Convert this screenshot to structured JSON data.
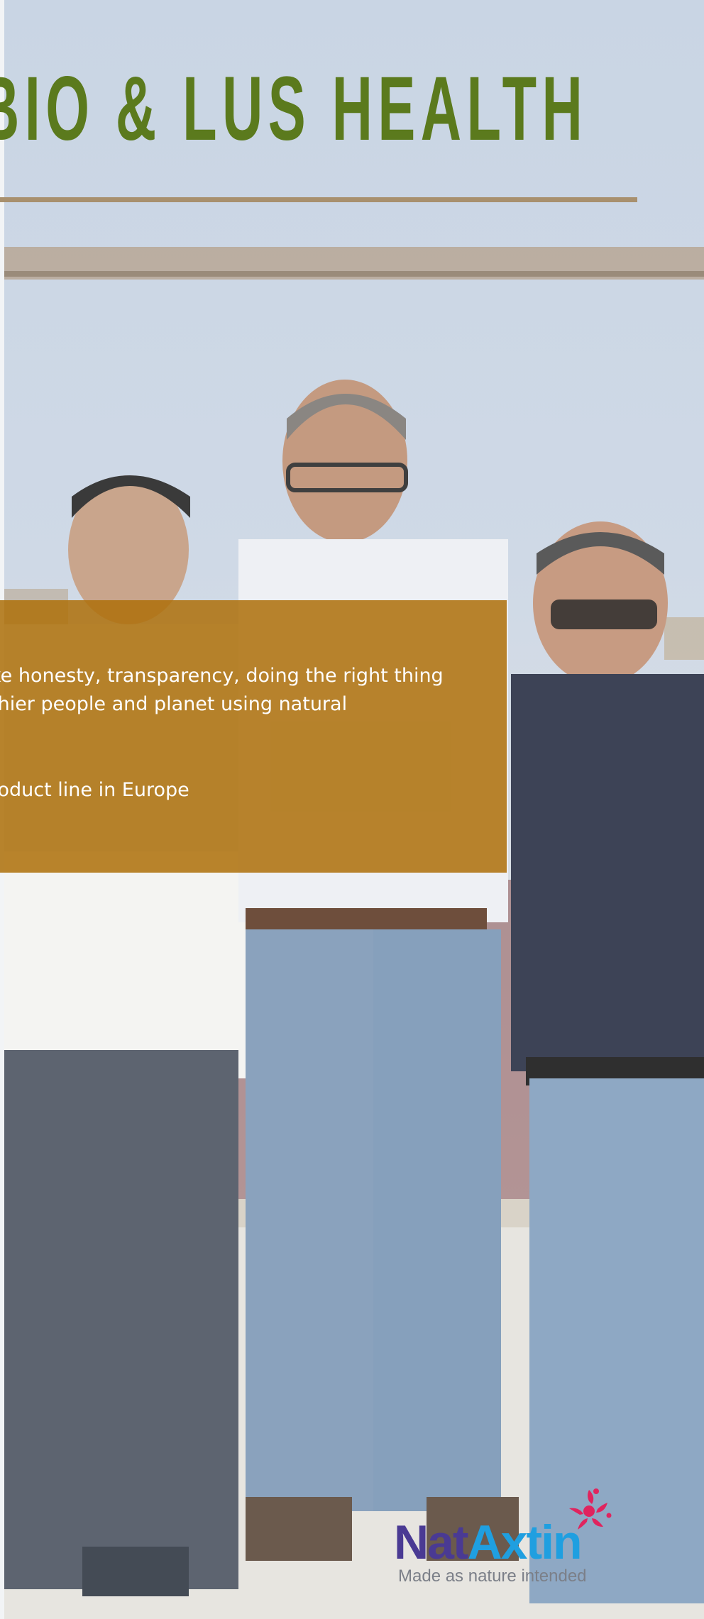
{
  "banner": {
    "title": "BIO  & LUS HEALTH"
  },
  "panel": {
    "lines": [
      "ke honesty, transparency,  doing the right thing",
      "thier people and planet using natural",
      "roduct line in Europe"
    ],
    "background_color": "#ad700a"
  },
  "logo": {
    "name_part1": "Nat",
    "name_part2": "Axtin",
    "tagline": "Made as nature intended",
    "icon": "sun-swirl-icon",
    "colors": {
      "nat": "#4a3a93",
      "axtin": "#1f9fe0",
      "mark": "#e0245e"
    }
  },
  "colors": {
    "title": "#5b7a1d",
    "rule": "#a8906e",
    "sky": "#c9d5e4"
  }
}
